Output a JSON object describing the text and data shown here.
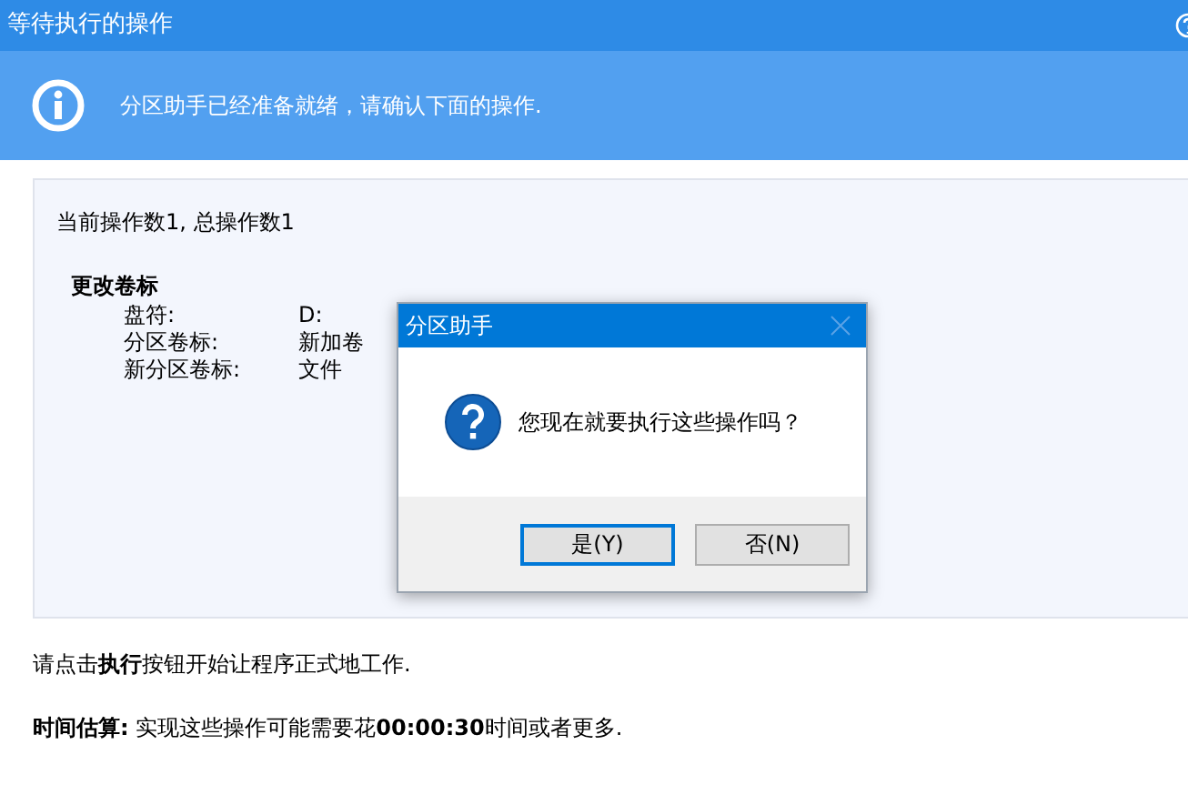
{
  "window": {
    "title": "等待执行的操作"
  },
  "banner": {
    "text": "分区助手已经准备就绪，请确认下面的操作."
  },
  "panel": {
    "summary": "当前操作数1, 总操作数1",
    "operation": {
      "title": "更改卷标",
      "fields": [
        {
          "label": "盘符:",
          "value": "D:"
        },
        {
          "label": "分区卷标:",
          "value": "新加卷"
        },
        {
          "label": "新分区卷标:",
          "value": "文件"
        }
      ]
    }
  },
  "instructions": [
    "请点击**执行**按钮开始让程序正式地工作.",
    "**时间估算:** 实现这些操作可能需要花**00:00:30**时间或者更多."
  ],
  "dialog": {
    "title": "分区助手",
    "message": "您现在就要执行这些操作吗？",
    "buttons": [
      {
        "label": "是(Y)",
        "selected": true
      },
      {
        "label": "否(N)",
        "selected": false
      }
    ]
  }
}
